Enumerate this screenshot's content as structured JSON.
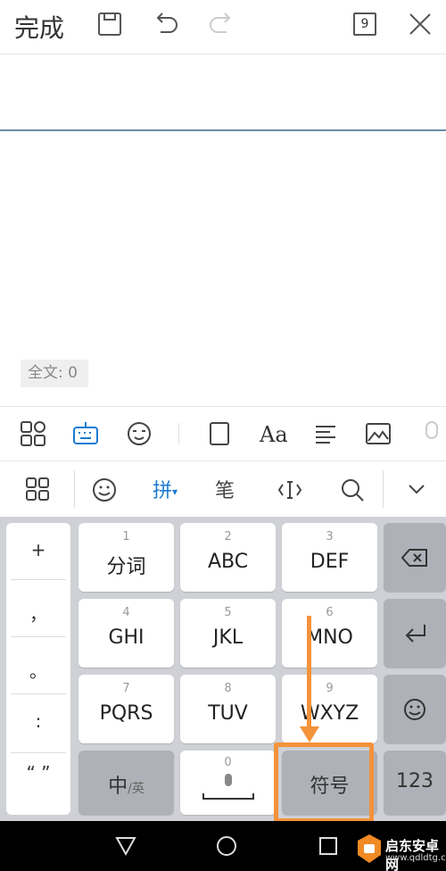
{
  "topbar": {
    "done_label": "完成",
    "page_badge": "9",
    "icons": [
      "save-icon",
      "undo-icon",
      "redo-icon",
      "page-count-icon",
      "close-icon"
    ]
  },
  "editor": {
    "word_count": "全文: 0"
  },
  "format_toolbar": {
    "icons": [
      "grid-apps-icon",
      "keyboard-icon",
      "emoji-face-icon",
      "fullscreen-icon",
      "font-icon",
      "align-icon",
      "image-icon",
      "mic-icon"
    ],
    "font_label": "Aa"
  },
  "ime_toolbar": {
    "icons": [
      "grid-icon",
      "smiley-icon",
      "cursor-icon",
      "search-icon",
      "chevron-down-icon"
    ],
    "pinyin_label": "拼",
    "stroke_label": "笔"
  },
  "keyboard": {
    "left_column": [
      "+",
      "，",
      "。",
      ":",
      "“ ”"
    ],
    "keys": [
      {
        "num": "1",
        "label": "分词"
      },
      {
        "num": "2",
        "label": "ABC"
      },
      {
        "num": "3",
        "label": "DEF"
      },
      {
        "num": "4",
        "label": "GHI"
      },
      {
        "num": "5",
        "label": "JKL"
      },
      {
        "num": "6",
        "label": "MNO"
      },
      {
        "num": "7",
        "label": "PQRS"
      },
      {
        "num": "8",
        "label": "TUV"
      },
      {
        "num": "9",
        "label": "WXYZ"
      }
    ],
    "bottom": {
      "lang_main": "中",
      "lang_sub": "/英",
      "space_num": "0",
      "symbol_label": "符号",
      "numeric_label": "123"
    }
  },
  "watermark": {
    "text": "启东安卓网",
    "url": "www.qdldtg.com"
  },
  "colors": {
    "accent_blue": "#1a7bd1",
    "annotation_orange": "#f4923a",
    "keyboard_bg": "#cfd1d6",
    "key_gray": "#aeb1b7"
  }
}
